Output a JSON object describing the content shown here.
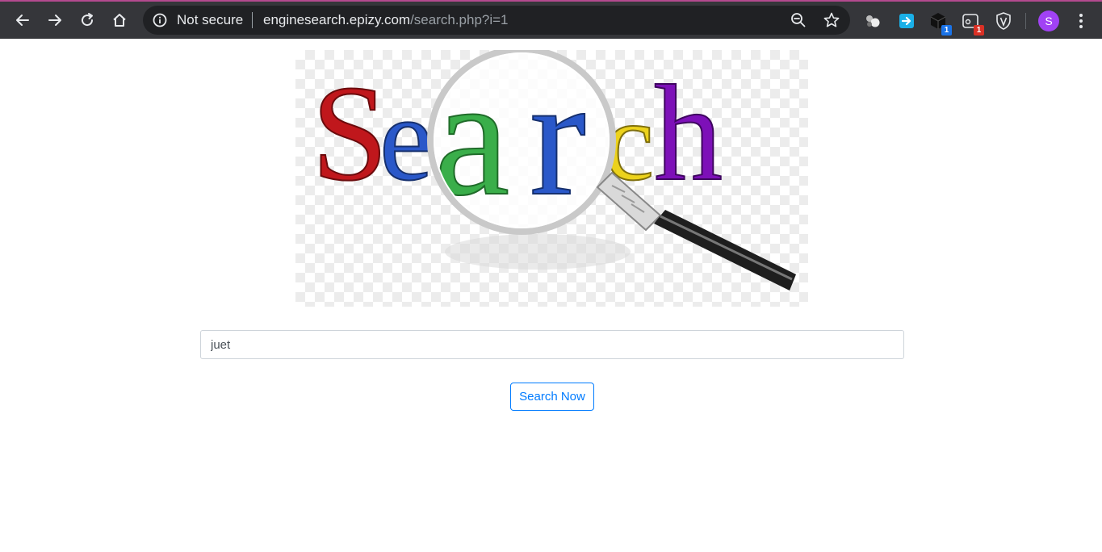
{
  "browser": {
    "security_label": "Not secure",
    "url_host": "enginesearch.epizy.com",
    "url_path": "/search.php?i=1",
    "extensions": [
      {
        "name": "extension-1",
        "badge": ""
      },
      {
        "name": "extension-2",
        "badge": ""
      },
      {
        "name": "extension-3",
        "badge": "1",
        "badge_color": "#1a73e8"
      },
      {
        "name": "extension-4",
        "badge": "1",
        "badge_color": "#d93025"
      },
      {
        "name": "extension-5",
        "badge": ""
      }
    ],
    "profile_initial": "S",
    "profile_color": "#a142f4"
  },
  "logo": {
    "text": "Search",
    "letter_colors": [
      "#c0171c",
      "#2a58c9",
      "#3aae4a",
      "#2a58c9",
      "#ecd21c",
      "#7d10b8"
    ]
  },
  "search": {
    "query_value": "juet",
    "button_label": "Search Now"
  }
}
